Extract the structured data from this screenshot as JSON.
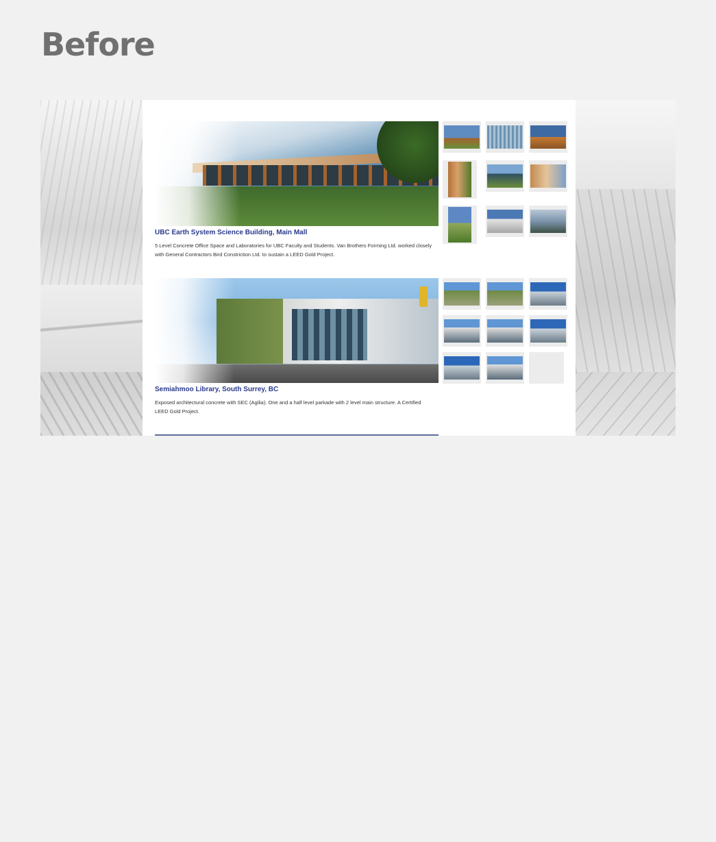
{
  "heading": "Before",
  "projects": [
    {
      "title": "UBC Earth System Science Building, Main Mall",
      "description": "5 Level Concrete Office Space and Laboratories for UBC Faculty and Students. Van Brothers Forming Ltd. worked closely with General Contractors Bird Constriction Ltd. to sustain a LEED Gold Project."
    },
    {
      "title": "Semiahmoo Library, South Surrey, BC",
      "description": "Exposed architectural concrete with SEC (Agilia). One and a half level parkade with 2 level main structure. A Certified LEED Gold Project."
    }
  ],
  "colors": {
    "page_background": "#f1f1f1",
    "heading": "#707070",
    "project_title": "#2a3a8c"
  }
}
